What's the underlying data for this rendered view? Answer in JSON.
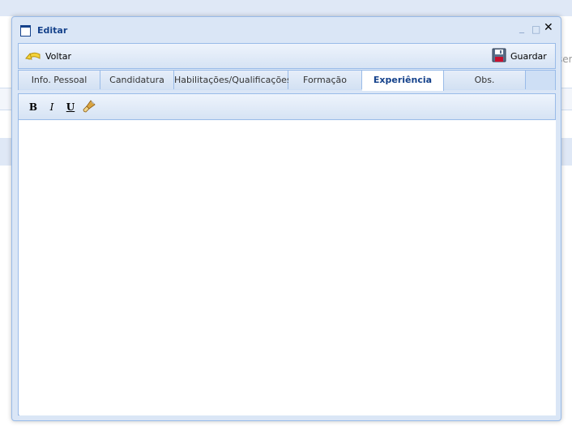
{
  "window": {
    "title": "Editar",
    "tools": {
      "minimize": "_",
      "maximize": "□",
      "close": "✕"
    }
  },
  "background": {
    "partial_text": "ser"
  },
  "toolbar": {
    "back_label": "Voltar",
    "save_label": "Guardar"
  },
  "tabs": [
    {
      "label": "Info. Pessoal",
      "active": false
    },
    {
      "label": "Candidatura",
      "active": false
    },
    {
      "label": "Habilitações/Qualificações",
      "active": false
    },
    {
      "label": "Formação",
      "active": false
    },
    {
      "label": "Experiência",
      "active": true
    },
    {
      "label": "Obs.",
      "active": false
    }
  ],
  "editor": {
    "bold": "B",
    "italic": "I",
    "underline": "U",
    "content": ""
  },
  "colors": {
    "window_bg": "#dae6f6",
    "border": "#99bbe8",
    "title_text": "#15428b"
  }
}
